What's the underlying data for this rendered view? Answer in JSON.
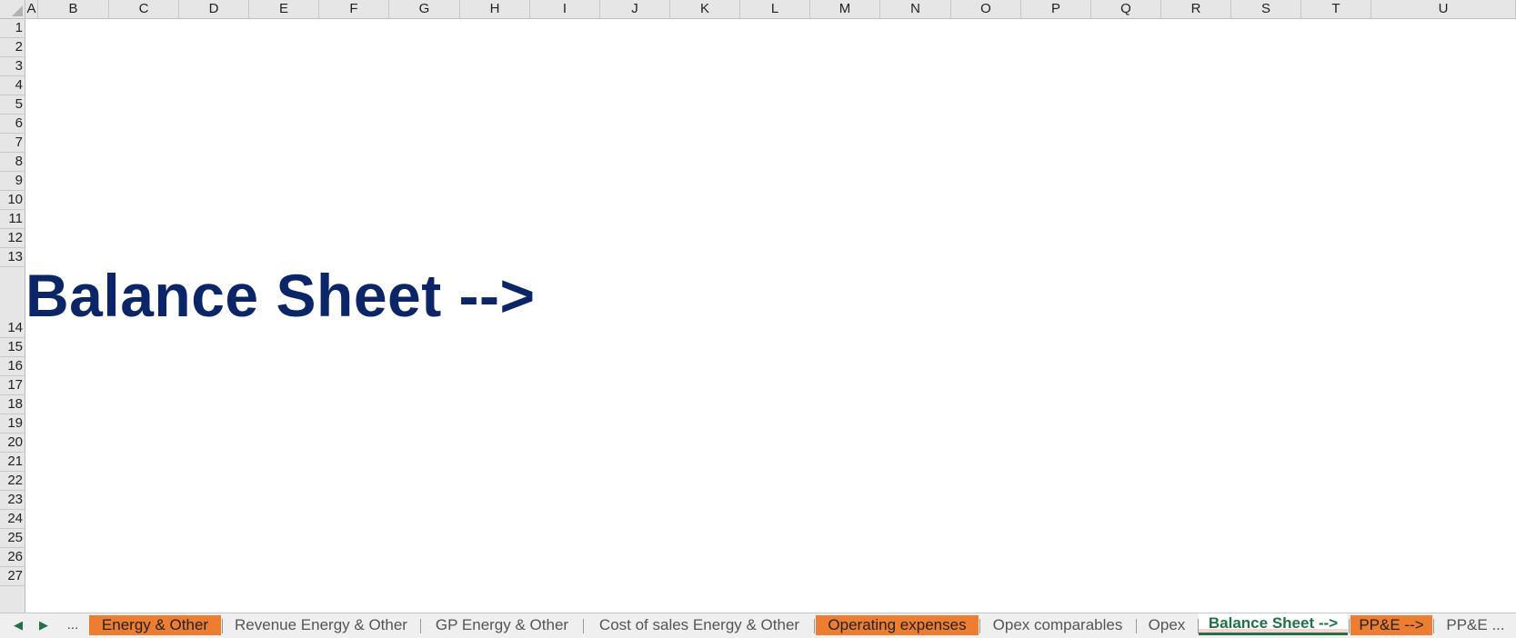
{
  "columns": [
    "A",
    "B",
    "C",
    "D",
    "E",
    "F",
    "G",
    "H",
    "I",
    "J",
    "K",
    "L",
    "M",
    "N",
    "O",
    "P",
    "Q",
    "R",
    "S",
    "T",
    "U"
  ],
  "rows": [
    "1",
    "2",
    "3",
    "4",
    "5",
    "6",
    "7",
    "8",
    "9",
    "10",
    "11",
    "12",
    "13",
    "14",
    "15",
    "16",
    "17",
    "18",
    "19",
    "20",
    "21",
    "22",
    "23",
    "24",
    "25",
    "26",
    "27"
  ],
  "cells": {
    "B14": "Balance Sheet -->"
  },
  "sheet_nav": {
    "prev_icon": "triangle-left-icon",
    "next_icon": "triangle-right-icon",
    "more_label": "..."
  },
  "tabs": [
    {
      "label": "Energy & Other",
      "color": "#ED7D31",
      "active": false
    },
    {
      "label": "Revenue Energy & Other",
      "color": "",
      "active": false
    },
    {
      "label": "GP Energy & Other",
      "color": "",
      "active": false
    },
    {
      "label": "Cost of sales Energy & Other",
      "color": "",
      "active": false
    },
    {
      "label": "Operating expenses",
      "color": "#ED7D31",
      "active": false
    },
    {
      "label": "Opex comparables",
      "color": "",
      "active": false
    },
    {
      "label": "Opex",
      "color": "",
      "active": false
    },
    {
      "label": "Balance Sheet -->",
      "color": "",
      "active": true
    },
    {
      "label": "PP&E -->",
      "color": "#ED7D31",
      "active": false
    },
    {
      "label": "PP&E ...",
      "color": "",
      "active": false
    }
  ],
  "colors": {
    "title_text": "#0B2566",
    "active_tab_text": "#207245",
    "orange_tab": "#ED7D31"
  }
}
